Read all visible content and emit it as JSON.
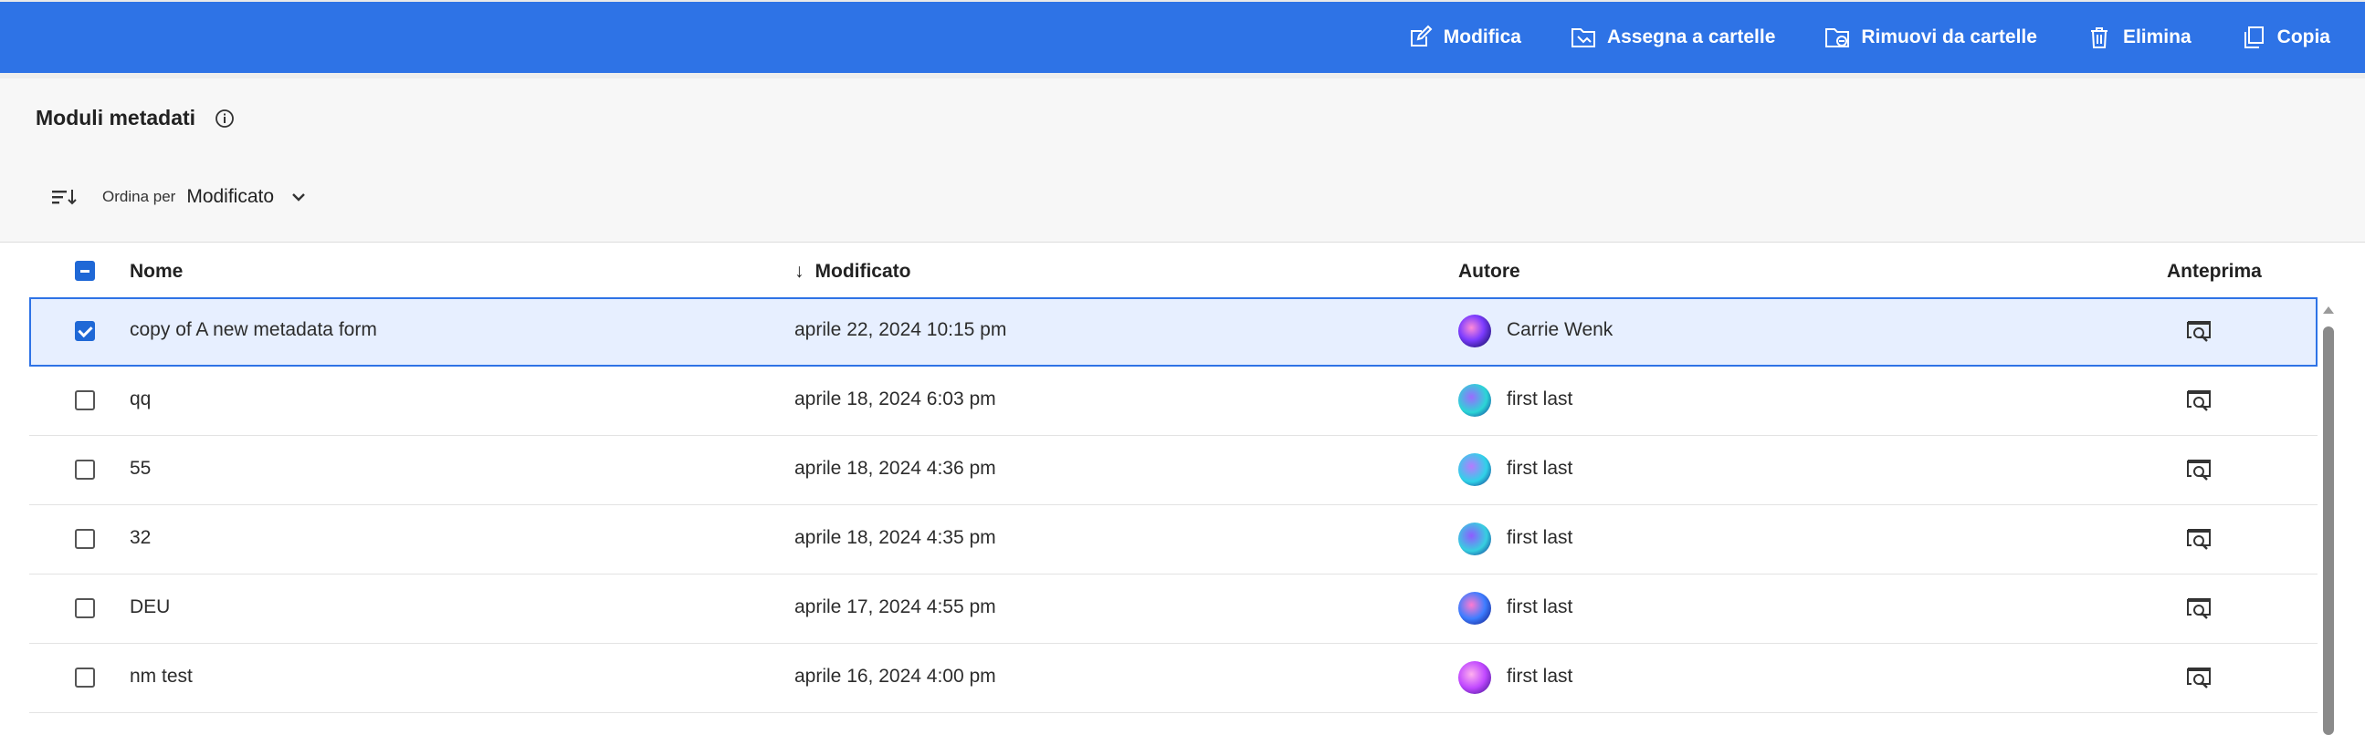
{
  "toolbar": {
    "actions": [
      {
        "label": "Modifica",
        "icon": "edit-icon"
      },
      {
        "label": "Assegna a cartelle",
        "icon": "assign-folder-icon"
      },
      {
        "label": "Rimuovi da cartelle",
        "icon": "remove-folder-icon"
      },
      {
        "label": "Elimina",
        "icon": "trash-icon"
      },
      {
        "label": "Copia",
        "icon": "copy-icon"
      }
    ],
    "background": "#2e73e6"
  },
  "header": {
    "title": "Moduli metadati",
    "sort_label": "Ordina per",
    "sort_value": "Modificato"
  },
  "table": {
    "columns": {
      "name": "Nome",
      "modified": "Modificato",
      "author": "Autore",
      "preview": "Anteprima"
    },
    "rows": [
      {
        "name": "copy of A new metadata form",
        "modified": "aprile 22, 2024 10:15 pm",
        "author": "Carrie Wenk",
        "selected": true
      },
      {
        "name": "qq",
        "modified": "aprile 18, 2024 6:03 pm",
        "author": "first last",
        "selected": false
      },
      {
        "name": "55",
        "modified": "aprile 18, 2024 4:36 pm",
        "author": "first last",
        "selected": false
      },
      {
        "name": "32",
        "modified": "aprile 18, 2024 4:35 pm",
        "author": "first last",
        "selected": false
      },
      {
        "name": "DEU",
        "modified": "aprile 17, 2024 4:55 pm",
        "author": "first last",
        "selected": false
      },
      {
        "name": "nm test",
        "modified": "aprile 16, 2024 4:00 pm",
        "author": "first last",
        "selected": false
      }
    ]
  },
  "colors": {
    "accent": "#2e73e6",
    "selected_row": "#e7efff"
  }
}
